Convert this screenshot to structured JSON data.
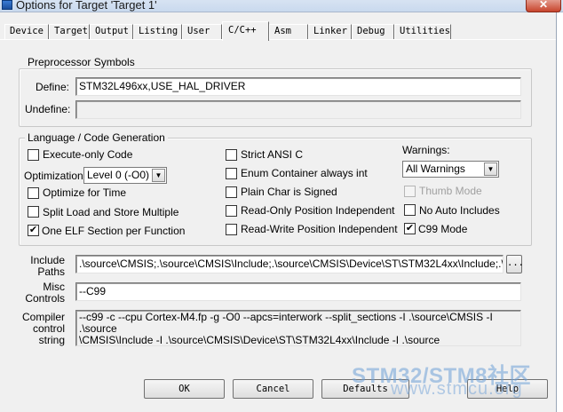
{
  "window": {
    "title": "Options for Target 'Target 1'",
    "close_label": "✕"
  },
  "tabs": [
    "Device",
    "Target",
    "Output",
    "Listing",
    "User",
    "C/C++",
    "Asm",
    "Linker",
    "Debug",
    "Utilities"
  ],
  "active_tab": "C/C++",
  "preprocessor": {
    "group_label": "Preprocessor Symbols",
    "define_label": "Define:",
    "define_value": "STM32L496xx,USE_HAL_DRIVER",
    "undefine_label": "Undefine:",
    "undefine_value": ""
  },
  "language": {
    "group_label": "Language / Code Generation",
    "execute_only": {
      "label": "Execute-only Code",
      "checked": false
    },
    "optimization_label": "Optimization:",
    "optimization_value": "Level 0 (-O0)",
    "optimize_time": {
      "label": "Optimize for Time",
      "checked": false
    },
    "split_load": {
      "label": "Split Load and Store Multiple",
      "checked": false
    },
    "one_elf": {
      "label": "One ELF Section per Function",
      "checked": true
    },
    "strict_ansi": {
      "label": "Strict ANSI C",
      "checked": false
    },
    "enum_container": {
      "label": "Enum Container always int",
      "checked": false
    },
    "plain_char": {
      "label": "Plain Char is Signed",
      "checked": false
    },
    "ropi": {
      "label": "Read-Only Position Independent",
      "checked": false
    },
    "rwpi": {
      "label": "Read-Write Position Independent",
      "checked": false
    },
    "warnings_label": "Warnings:",
    "warnings_value": "All Warnings",
    "thumb_mode": {
      "label": "Thumb Mode",
      "checked": false,
      "disabled": true
    },
    "no_auto_includes": {
      "label": "No Auto Includes",
      "checked": false
    },
    "c99_mode": {
      "label": "C99 Mode",
      "checked": true
    }
  },
  "include_paths": {
    "label_line1": "Include",
    "label_line2": "Paths",
    "value": ".\\source\\CMSIS;.\\source\\CMSIS\\Include;.\\source\\CMSIS\\Device\\ST\\STM32L4xx\\Include;.\\source",
    "browse_label": "..."
  },
  "misc_controls": {
    "label_line1": "Misc",
    "label_line2": "Controls",
    "value": "--C99"
  },
  "compiler_control": {
    "label_line1": "Compiler",
    "label_line2": "control",
    "label_line3": "string",
    "value": "--c99 -c --cpu Cortex-M4.fp -g -O0 --apcs=interwork --split_sections -I .\\source\\CMSIS -I .\\source\n\\CMSIS\\Include -I .\\source\\CMSIS\\Device\\ST\\STM32L4xx\\Include -I .\\source"
  },
  "buttons": {
    "ok": "OK",
    "cancel": "Cancel",
    "defaults": "Defaults",
    "help": "Help"
  },
  "watermark": {
    "line1": "STM32/STM8社区",
    "line2": "www.stmcu.org"
  }
}
